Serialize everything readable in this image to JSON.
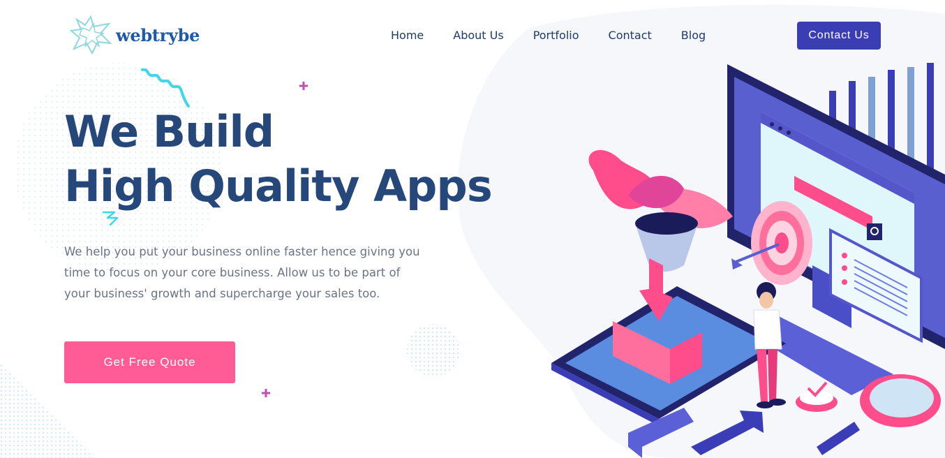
{
  "brand": {
    "name": "webtrybe",
    "logo_icon": "starburst-logo-icon",
    "colors": {
      "primary": "#3b3eb3",
      "accent": "#ff5c95",
      "heading": "#26477a",
      "body_text": "#6a7386"
    }
  },
  "nav": {
    "items": [
      {
        "label": "Home"
      },
      {
        "label": "About Us"
      },
      {
        "label": "Portfolio"
      },
      {
        "label": "Contact"
      },
      {
        "label": "Blog"
      }
    ],
    "cta_label": "Contact Us"
  },
  "hero": {
    "title_line1": "We Build",
    "title_line2": "High Quality Apps",
    "description": "We help you put your business online faster hence giving you time to focus on your core business. Allow us to be part of your business' growth and supercharge your sales too.",
    "button_label": "Get Free Quote"
  },
  "illustration": {
    "icon": "isometric-app-development-illustration"
  }
}
